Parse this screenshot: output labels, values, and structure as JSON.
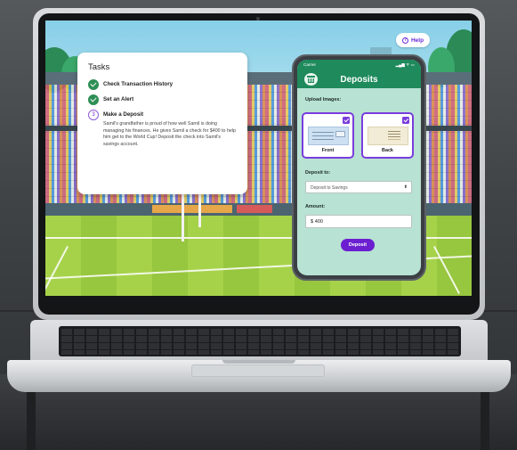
{
  "help": {
    "label": "Help",
    "icon": "question-icon"
  },
  "tasks": {
    "title": "Tasks",
    "items": [
      {
        "status": "done",
        "label": "Check Transaction History"
      },
      {
        "status": "done",
        "label": "Set an Alert"
      },
      {
        "status": "current",
        "number": "3",
        "label": "Make a Deposit",
        "description": "Samil's grandfather is proud of how well Samil is doing managing his finances.  He gives Samil a check for $400 to help him get to the World Cup! Deposit the check into Samil's savings account."
      }
    ]
  },
  "phone": {
    "status": {
      "carrier": "Carrier",
      "icons": "▂▄▆ ᯤ ▭"
    },
    "app_title": "Deposits",
    "upload_heading": "Upload Images:",
    "images": [
      {
        "label": "Front",
        "checked": true
      },
      {
        "label": "Back",
        "checked": true
      }
    ],
    "deposit_to_heading": "Deposit to:",
    "deposit_to_value": "Deposit to Savings",
    "amount_heading": "Amount:",
    "amount_currency": "$",
    "amount_value": "400",
    "deposit_button": "Deposit"
  },
  "colors": {
    "brand_green": "#1f8a5c",
    "accent_purple": "#6b1fd0",
    "phone_bg": "#b8e2d3"
  }
}
